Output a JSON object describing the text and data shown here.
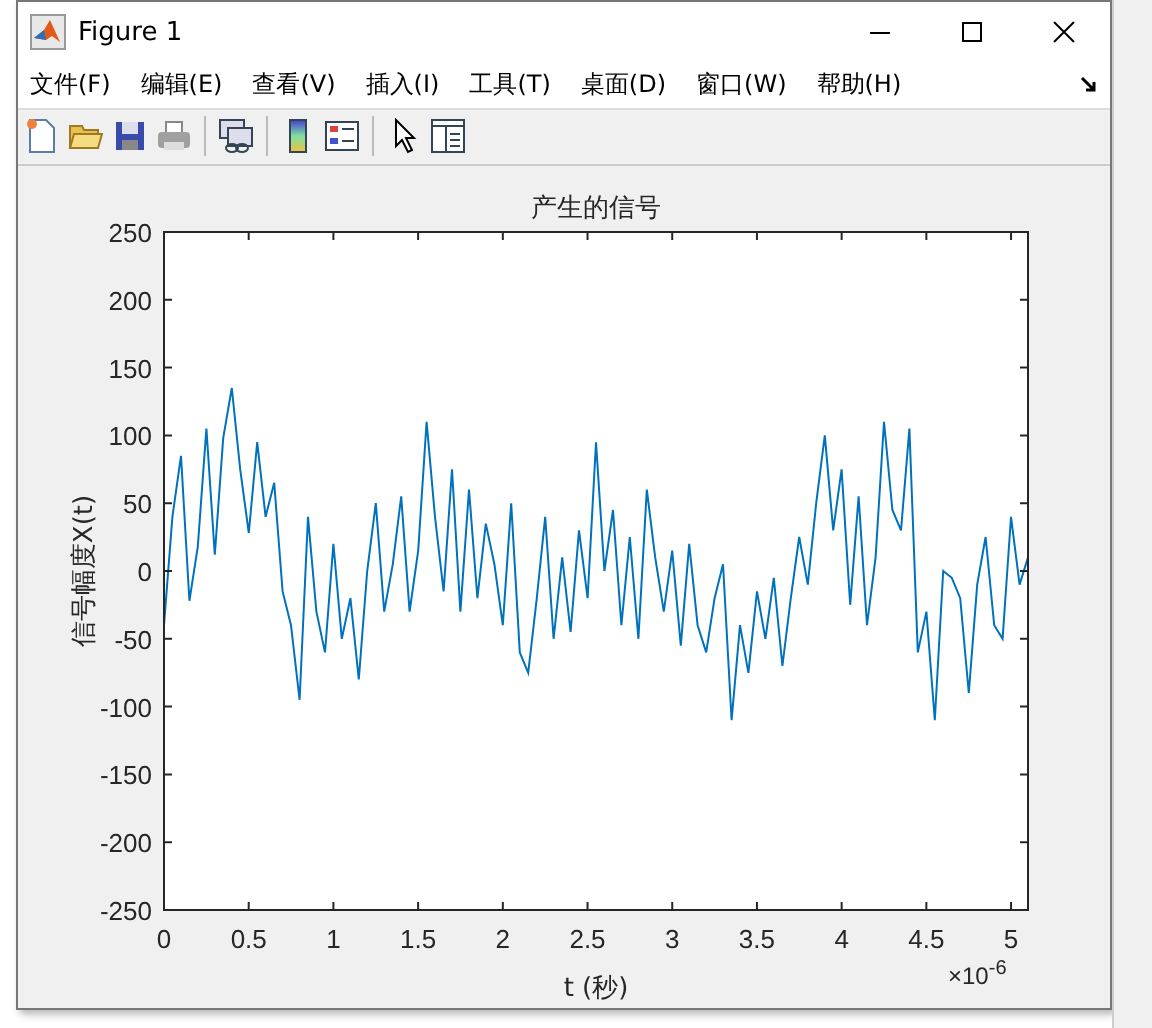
{
  "window": {
    "title": "Figure 1"
  },
  "menu": [
    {
      "label": "文件(F)"
    },
    {
      "label": "编辑(E)"
    },
    {
      "label": "查看(V)"
    },
    {
      "label": "插入(I)"
    },
    {
      "label": "工具(T)"
    },
    {
      "label": "桌面(D)"
    },
    {
      "label": "窗口(W)"
    },
    {
      "label": "帮助(H)"
    }
  ],
  "toolbar": [
    {
      "kind": "new"
    },
    {
      "kind": "open"
    },
    {
      "kind": "save"
    },
    {
      "kind": "print"
    },
    {
      "kind": "sep"
    },
    {
      "kind": "link"
    },
    {
      "kind": "sep"
    },
    {
      "kind": "colorbar"
    },
    {
      "kind": "legend"
    },
    {
      "kind": "sep"
    },
    {
      "kind": "pointer"
    },
    {
      "kind": "panel"
    }
  ],
  "axes": {
    "x_exponent": "×10$^{-6}$",
    "chart_data": {
      "type": "line",
      "title": "产生的信号",
      "xlabel": "t (秒)",
      "ylabel": "信号幅度X(t)",
      "xlim": [
        0,
        5.1
      ],
      "ylim": [
        -250,
        250
      ],
      "xticks": [
        0,
        0.5,
        1,
        1.5,
        2,
        2.5,
        3,
        3.5,
        4,
        4.5,
        5
      ],
      "yticks": [
        -250,
        -200,
        -150,
        -100,
        -50,
        0,
        50,
        100,
        150,
        200,
        250
      ],
      "x": [
        0,
        0.05,
        0.1,
        0.15,
        0.2,
        0.25,
        0.3,
        0.35,
        0.4,
        0.45,
        0.5,
        0.55,
        0.6,
        0.65,
        0.7,
        0.75,
        0.8,
        0.85,
        0.9,
        0.95,
        1,
        1.05,
        1.1,
        1.15,
        1.2,
        1.25,
        1.3,
        1.35,
        1.4,
        1.45,
        1.5,
        1.55,
        1.6,
        1.65,
        1.7,
        1.75,
        1.8,
        1.85,
        1.9,
        1.95,
        2,
        2.05,
        2.1,
        2.15,
        2.2,
        2.25,
        2.3,
        2.35,
        2.4,
        2.45,
        2.5,
        2.55,
        2.6,
        2.65,
        2.7,
        2.75,
        2.8,
        2.85,
        2.9,
        2.95,
        3,
        3.05,
        3.1,
        3.15,
        3.2,
        3.25,
        3.3,
        3.35,
        3.4,
        3.45,
        3.5,
        3.55,
        3.6,
        3.65,
        3.7,
        3.75,
        3.8,
        3.85,
        3.9,
        3.95,
        4,
        4.05,
        4.1,
        4.15,
        4.2,
        4.25,
        4.3,
        4.35,
        4.4,
        4.45,
        4.5,
        4.55,
        4.6,
        4.65,
        4.7,
        4.75,
        4.8,
        4.85,
        4.9,
        4.95,
        5,
        5.05,
        5.1
      ],
      "series": [
        {
          "color": "#0072bd",
          "values": [
            -40,
            40,
            85,
            -22,
            18,
            105,
            12,
            98,
            135,
            75,
            28,
            95,
            40,
            65,
            -15,
            -40,
            -95,
            40,
            -30,
            -60,
            20,
            -50,
            -20,
            -80,
            0,
            50,
            -30,
            5,
            55,
            -30,
            15,
            110,
            40,
            -15,
            75,
            -30,
            60,
            -20,
            35,
            5,
            -40,
            50,
            -60,
            -75,
            -20,
            40,
            -50,
            10,
            -45,
            30,
            -20,
            95,
            0,
            45,
            -40,
            25,
            -50,
            60,
            10,
            -30,
            15,
            -55,
            20,
            -40,
            -60,
            -20,
            5,
            -110,
            -40,
            -75,
            -15,
            -50,
            -5,
            -70,
            -20,
            25,
            -10,
            50,
            100,
            30,
            75,
            -25,
            55,
            -40,
            10,
            110,
            45,
            30,
            105,
            -60,
            -30,
            -110,
            0,
            -5,
            -20,
            -90,
            -10,
            25,
            -40,
            -50,
            40,
            -10,
            10
          ]
        }
      ]
    }
  }
}
